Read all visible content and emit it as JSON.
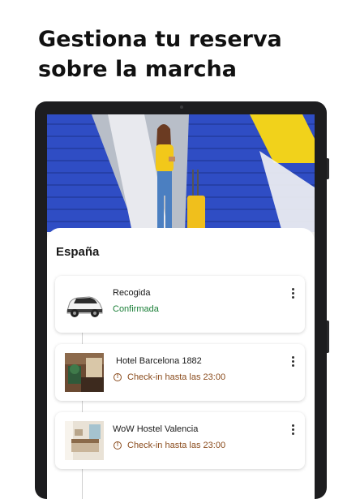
{
  "headline": {
    "line1": "Gestiona tu reserva",
    "line2": "sobre la marcha"
  },
  "sheet": {
    "title": "España"
  },
  "bookings": [
    {
      "title": "Recogida",
      "status": "Confirmada",
      "status_color": "#1a7f37"
    },
    {
      "title": "Hotel Barcelona 1882",
      "status": "Check-in hasta las 23:00",
      "status_color": "#8a4b1c"
    },
    {
      "title": "WoW Hostel Valencia",
      "status": "Check-in hasta las 23:00",
      "status_color": "#8a4b1c"
    }
  ],
  "icons": {
    "car": "car-icon",
    "info": "info-icon",
    "more": "more-vertical-icon"
  }
}
